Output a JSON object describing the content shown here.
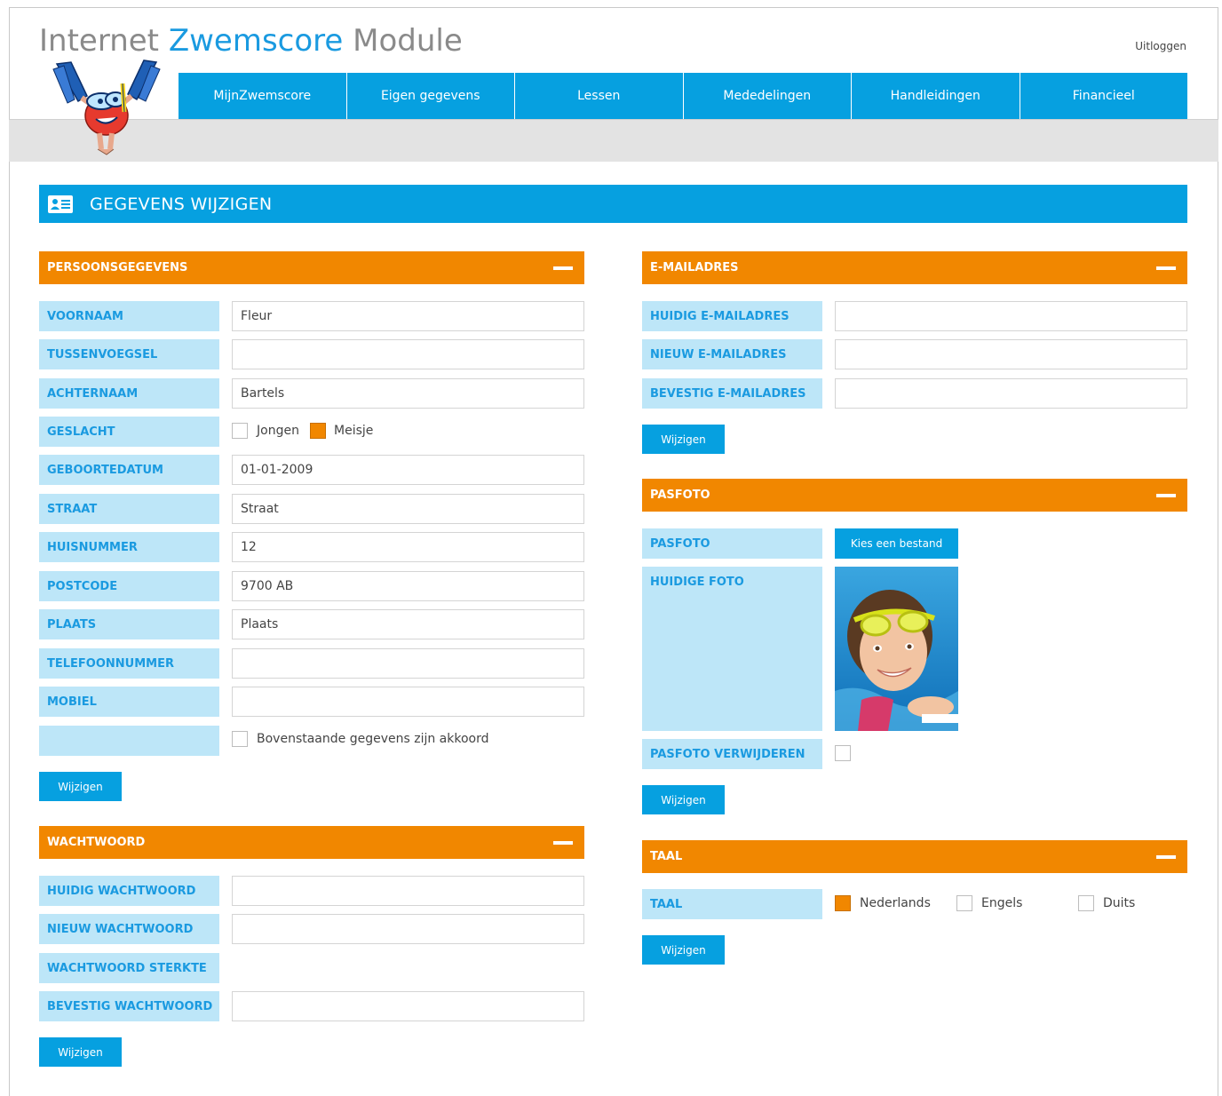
{
  "header": {
    "title_part1": "Internet ",
    "title_part2": "Zwemscore",
    "title_part3": " Module",
    "logout": "Uitloggen"
  },
  "nav": [
    "MijnZwemscore",
    "Eigen gegevens",
    "Lessen",
    "Mededelingen",
    "Handleidingen",
    "Financieel"
  ],
  "page_title": "GEGEVENS WIJZIGEN",
  "persoon": {
    "heading": "PERSOONSGEGEVENS",
    "voornaam_label": "VOORNAAM",
    "voornaam": "Fleur",
    "tussenvoegsel_label": "TUSSENVOEGSEL",
    "tussenvoegsel": "",
    "achternaam_label": "ACHTERNAAM",
    "achternaam": "Bartels",
    "geslacht_label": "GESLACHT",
    "jongen": "Jongen",
    "meisje": "Meisje",
    "geboortedatum_label": "GEBOORTEDATUM",
    "geboortedatum": "01-01-2009",
    "straat_label": "STRAAT",
    "straat": "Straat",
    "huisnummer_label": "HUISNUMMER",
    "huisnummer": "12",
    "postcode_label": "POSTCODE",
    "postcode": "9700 AB",
    "plaats_label": "PLAATS",
    "plaats": "Plaats",
    "telefoon_label": "TELEFOONNUMMER",
    "telefoon": "",
    "mobiel_label": "MOBIEL",
    "mobiel": "",
    "akkoord": "Bovenstaande gegevens zijn akkoord",
    "button": "Wijzigen"
  },
  "wachtwoord": {
    "heading": "WACHTWOORD",
    "huidig_label": "HUIDIG WACHTWOORD",
    "nieuw_label": "NIEUW WACHTWOORD",
    "sterkte_label": "WACHTWOORD STERKTE",
    "bevestig_label": "BEVESTIG WACHTWOORD",
    "button": "Wijzigen"
  },
  "email": {
    "heading": "E-MAILADRES",
    "huidig_label": "HUIDIG E-MAILADRES",
    "nieuw_label": "NIEUW E-MAILADRES",
    "bevestig_label": "BEVESTIG E-MAILADRES",
    "button": "Wijzigen"
  },
  "pasfoto": {
    "heading": "PASFOTO",
    "pasfoto_label": "PASFOTO",
    "file_button": "Kies een bestand",
    "huidige_label": "HUIDIGE FOTO",
    "verwijderen_label": "PASFOTO VERWIJDEREN",
    "button": "Wijzigen"
  },
  "taal": {
    "heading": "TAAL",
    "taal_label": "TAAL",
    "nederlands": "Nederlands",
    "engels": "Engels",
    "duits": "Duits",
    "button": "Wijzigen"
  },
  "colors": {
    "accent_blue": "#06a0e0",
    "accent_orange": "#f18700",
    "label_bg": "#bde6f8"
  },
  "icons": {
    "logo": "diver-mascot-logo",
    "page_title_icon": "id-card-icon",
    "collapse": "minus-icon"
  },
  "state": {
    "geslacht": "Meisje",
    "taal": "Nederlands",
    "akkoord_checked": false,
    "verwijderen_checked": false
  }
}
